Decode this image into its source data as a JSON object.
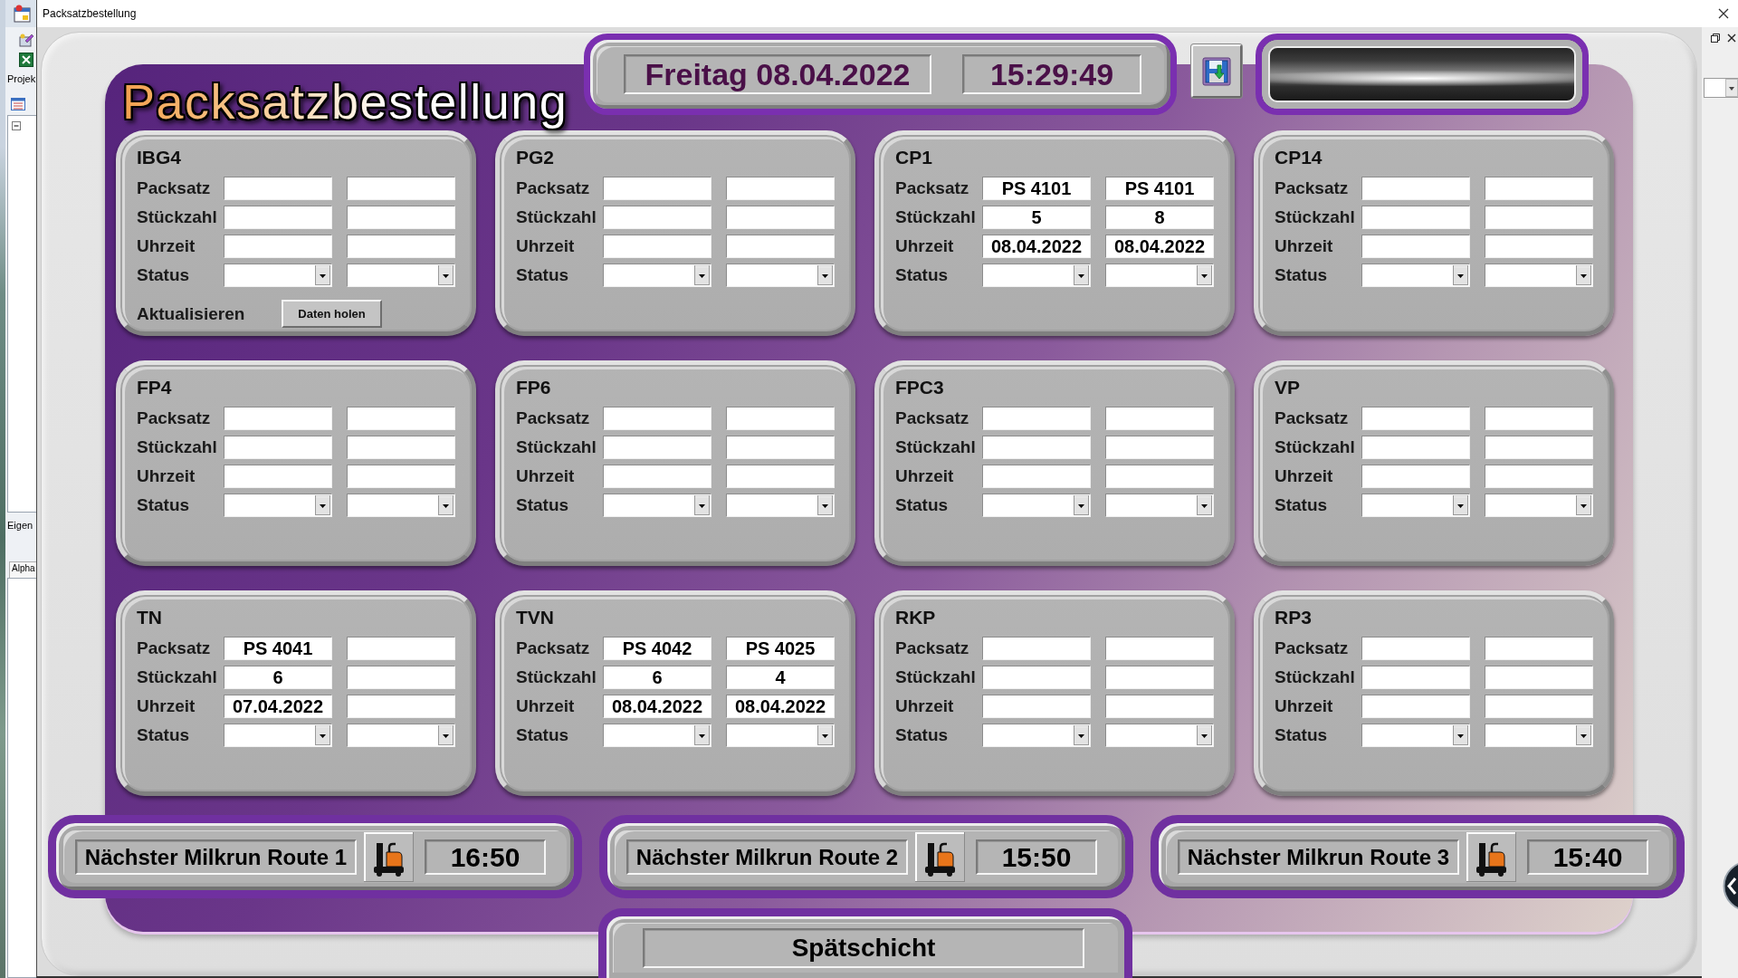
{
  "background_window": {
    "pane_title": "Projek",
    "pane_label": "Eigen",
    "tab": "Alpha"
  },
  "window": {
    "title": "Packsatzbestellung"
  },
  "heading": "Packsatzbestellung",
  "header": {
    "date": "Freitag 08.04.2022",
    "time": "15:29:49"
  },
  "panels": [
    {
      "title": "IBG4",
      "rows": [
        {
          "label": "Packsatz",
          "kind": "text"
        },
        {
          "label": "Stückzahl",
          "kind": "text"
        },
        {
          "label": "Uhrzeit",
          "kind": "text"
        },
        {
          "label": "Status",
          "kind": "dropdown"
        }
      ],
      "refresh": {
        "label": "Aktualisieren",
        "button": "Daten holen"
      }
    },
    {
      "title": "PG2",
      "rows": [
        {
          "label": "Packsatz",
          "kind": "text"
        },
        {
          "label": "Stückzahl",
          "kind": "text"
        },
        {
          "label": "Uhrzeit",
          "kind": "text"
        },
        {
          "label": "Status",
          "kind": "dropdown"
        }
      ]
    },
    {
      "title": "CP1",
      "rows": [
        {
          "label": "Packsatz",
          "kind": "text",
          "values": [
            "PS 4101",
            "PS 4101"
          ]
        },
        {
          "label": "Stückzahl",
          "kind": "text",
          "values": [
            "5",
            "8"
          ]
        },
        {
          "label": "Uhrzeit",
          "kind": "text",
          "values": [
            "08.04.2022",
            "08.04.2022"
          ]
        },
        {
          "label": "Status",
          "kind": "dropdown"
        }
      ]
    },
    {
      "title": "CP14",
      "rows": [
        {
          "label": "Packsatz",
          "kind": "text"
        },
        {
          "label": "Stückzahl",
          "kind": "text"
        },
        {
          "label": "Uhrzeit",
          "kind": "text"
        },
        {
          "label": "Status",
          "kind": "dropdown"
        }
      ]
    },
    {
      "title": "FP4",
      "rows": [
        {
          "label": "Packsatz",
          "kind": "text"
        },
        {
          "label": "Stückzahl",
          "kind": "text"
        },
        {
          "label": "Uhrzeit",
          "kind": "text"
        },
        {
          "label": "Status",
          "kind": "dropdown"
        }
      ]
    },
    {
      "title": "FP6",
      "rows": [
        {
          "label": "Packsatz",
          "kind": "text"
        },
        {
          "label": "Stückzahl",
          "kind": "text"
        },
        {
          "label": "Uhrzeit",
          "kind": "text"
        },
        {
          "label": "Status",
          "kind": "dropdown"
        }
      ]
    },
    {
      "title": "FPC3",
      "rows": [
        {
          "label": "Packsatz",
          "kind": "text"
        },
        {
          "label": "Stückzahl",
          "kind": "text"
        },
        {
          "label": "Uhrzeit",
          "kind": "text"
        },
        {
          "label": "Status",
          "kind": "dropdown"
        }
      ]
    },
    {
      "title": "VP",
      "rows": [
        {
          "label": "Packsatz",
          "kind": "text"
        },
        {
          "label": "Stückzahl",
          "kind": "text"
        },
        {
          "label": "Uhrzeit",
          "kind": "text"
        },
        {
          "label": "Status",
          "kind": "dropdown"
        }
      ]
    },
    {
      "title": "TN",
      "rows": [
        {
          "label": "Packsatz",
          "kind": "text",
          "values": [
            "PS 4041"
          ]
        },
        {
          "label": "Stückzahl",
          "kind": "text",
          "values": [
            "6"
          ]
        },
        {
          "label": "Uhrzeit",
          "kind": "text",
          "values": [
            "07.04.2022"
          ]
        },
        {
          "label": "Status",
          "kind": "dropdown"
        }
      ]
    },
    {
      "title": "TVN",
      "rows": [
        {
          "label": "Packsatz",
          "kind": "text",
          "values": [
            "PS 4042",
            "PS 4025"
          ]
        },
        {
          "label": "Stückzahl",
          "kind": "text",
          "values": [
            "6",
            "4"
          ]
        },
        {
          "label": "Uhrzeit",
          "kind": "text",
          "values": [
            "08.04.2022",
            "08.04.2022"
          ]
        },
        {
          "label": "Status",
          "kind": "dropdown"
        }
      ]
    },
    {
      "title": "RKP",
      "rows": [
        {
          "label": "Packsatz",
          "kind": "text"
        },
        {
          "label": "Stückzahl",
          "kind": "text"
        },
        {
          "label": "Uhrzeit",
          "kind": "text"
        },
        {
          "label": "Status",
          "kind": "dropdown"
        }
      ]
    },
    {
      "title": "RP3",
      "rows": [
        {
          "label": "Packsatz",
          "kind": "text"
        },
        {
          "label": "Stückzahl",
          "kind": "text"
        },
        {
          "label": "Uhrzeit",
          "kind": "text"
        },
        {
          "label": "Status",
          "kind": "dropdown"
        }
      ]
    }
  ],
  "milkruns": [
    {
      "label": "Nächster Milkrun Route 1",
      "time": "16:50"
    },
    {
      "label": "Nächster Milkrun Route 2",
      "time": "15:50"
    },
    {
      "label": "Nächster Milkrun Route 3",
      "time": "15:40"
    }
  ],
  "shift": "Spätschicht"
}
